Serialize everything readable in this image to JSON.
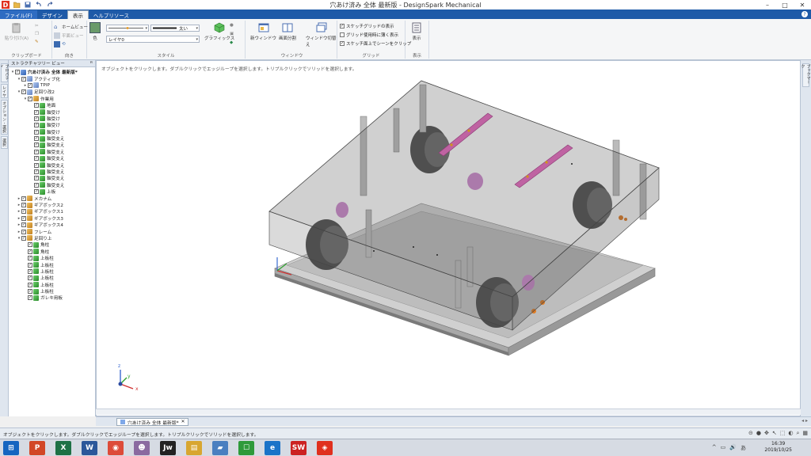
{
  "window": {
    "title": "穴あけ済み 全体 最新版 - DesignSpark Mechanical",
    "controls": {
      "minimize": "–",
      "maximize": "□",
      "close": "✕"
    }
  },
  "quick_access": {
    "icons": [
      "app-logo",
      "open-icon",
      "save-icon",
      "undo-icon",
      "redo-icon"
    ],
    "logo_letter": "D"
  },
  "tabs": {
    "items": [
      {
        "label": "ファイル(F)"
      },
      {
        "label": "デザイン"
      },
      {
        "label": "表示"
      },
      {
        "label": "ヘルプリソース"
      }
    ],
    "active_index": 2,
    "help": "?"
  },
  "ribbon": {
    "clipboard": {
      "paste": "貼り付け(A)",
      "group": "クリップボード"
    },
    "orient": {
      "home": "ホームビュー",
      "plane": "平面ビュー",
      "group": "向き"
    },
    "style": {
      "color": "色",
      "weight": "太い",
      "layer": "レイヤ0",
      "graphics": "グラフィックス",
      "group": "スタイル"
    },
    "window": {
      "new_window": "新ウィンドウ",
      "split": "画面分割",
      "switch": "ウィンドウ切替え",
      "group": "ウィンドウ"
    },
    "grid": {
      "options": [
        {
          "label": "スケッチグリッドの表示",
          "checked": true
        },
        {
          "label": "グリッド使用時に薄く表示",
          "checked": false
        },
        {
          "label": "スケッチ面上でシーンをクリップ",
          "checked": true
        }
      ],
      "group": "グリッド"
    },
    "display": {
      "label": "表示",
      "group": "表示"
    }
  },
  "left_strip": {
    "tabs": [
      "プロパティ",
      "レイヤ",
      "オプション - 選択",
      "選択"
    ]
  },
  "right_strip": {
    "tabs": [
      "ブックマーク"
    ]
  },
  "structure_panel": {
    "title": "ストラクチャツリー ビュー",
    "pin": "ꟸ",
    "items": [
      {
        "label": "穴あけ済み 全体 最新版*",
        "level": 0,
        "icon": "root",
        "expand": "▾",
        "bold": true
      },
      {
        "label": "アクティブ化",
        "level": 1,
        "icon": "plane",
        "expand": "▾"
      },
      {
        "label": "TPIP",
        "level": 2,
        "icon": "plane",
        "expand": "▸"
      },
      {
        "label": "足回り改2",
        "level": 1,
        "icon": "plane",
        "expand": "▾"
      },
      {
        "label": "作業用",
        "level": 2,
        "icon": "comp",
        "expand": "▾"
      },
      {
        "label": "地面",
        "level": 3,
        "icon": "body",
        "expand": ""
      },
      {
        "label": "軸受け",
        "level": 3,
        "icon": "body",
        "expand": ""
      },
      {
        "label": "軸受け",
        "level": 3,
        "icon": "body",
        "expand": ""
      },
      {
        "label": "軸受け",
        "level": 3,
        "icon": "body",
        "expand": ""
      },
      {
        "label": "軸受け",
        "level": 3,
        "icon": "body",
        "expand": ""
      },
      {
        "label": "軸受支え",
        "level": 3,
        "icon": "body",
        "expand": ""
      },
      {
        "label": "軸受支え",
        "level": 3,
        "icon": "body",
        "expand": ""
      },
      {
        "label": "軸受支え",
        "level": 3,
        "icon": "body",
        "expand": ""
      },
      {
        "label": "軸受支え",
        "level": 3,
        "icon": "body",
        "expand": ""
      },
      {
        "label": "軸受支え",
        "level": 3,
        "icon": "body",
        "expand": ""
      },
      {
        "label": "軸受支え",
        "level": 3,
        "icon": "body",
        "expand": ""
      },
      {
        "label": "軸受支え",
        "level": 3,
        "icon": "body",
        "expand": ""
      },
      {
        "label": "軸受支え",
        "level": 3,
        "icon": "body",
        "expand": ""
      },
      {
        "label": "上板",
        "level": 3,
        "icon": "body",
        "expand": ""
      },
      {
        "label": "メカナム",
        "level": 1,
        "icon": "comp",
        "expand": "▸"
      },
      {
        "label": "ギアボックス2",
        "level": 1,
        "icon": "comp",
        "expand": "▸"
      },
      {
        "label": "ギアボックス1",
        "level": 1,
        "icon": "comp",
        "expand": "▸"
      },
      {
        "label": "ギアボックス3",
        "level": 1,
        "icon": "comp",
        "expand": "▸"
      },
      {
        "label": "ギアボックス4",
        "level": 1,
        "icon": "comp",
        "expand": "▸"
      },
      {
        "label": "フレーム",
        "level": 1,
        "icon": "comp",
        "expand": "▸"
      },
      {
        "label": "足回り上",
        "level": 1,
        "icon": "comp",
        "expand": "▾"
      },
      {
        "label": "角柱",
        "level": 2,
        "icon": "body",
        "expand": ""
      },
      {
        "label": "角柱",
        "level": 2,
        "icon": "body",
        "expand": ""
      },
      {
        "label": "上板柱",
        "level": 2,
        "icon": "body",
        "expand": ""
      },
      {
        "label": "上板柱",
        "level": 2,
        "icon": "body",
        "expand": ""
      },
      {
        "label": "上板柱",
        "level": 2,
        "icon": "body",
        "expand": ""
      },
      {
        "label": "上板柱",
        "level": 2,
        "icon": "body",
        "expand": ""
      },
      {
        "label": "上板柱",
        "level": 2,
        "icon": "body",
        "expand": ""
      },
      {
        "label": "上板柱",
        "level": 2,
        "icon": "body",
        "expand": ""
      },
      {
        "label": "ガレキ用板",
        "level": 2,
        "icon": "body",
        "expand": ""
      }
    ]
  },
  "viewport": {
    "hint": "オブジェクトをクリックします。ダブルクリックでエッジループを選択します。トリプルクリックでソリッドを選択します。",
    "axes": {
      "x": "x",
      "y": "y",
      "z": "z"
    }
  },
  "document_tab": {
    "label": "穴あけ済み 全体 最新版*",
    "close": "✕",
    "nav": "◂ ▸"
  },
  "status_bar": {
    "message": "オブジェクトをクリックします。ダブルクリックでエッジループを選択します。トリプルクリックでソリッドを選択します。"
  },
  "taskbar": {
    "apps": [
      {
        "name": "windows-start",
        "label": "⊞",
        "color": "#1565c0"
      },
      {
        "name": "powerpoint",
        "label": "P",
        "color": "#d24726"
      },
      {
        "name": "excel",
        "label": "X",
        "color": "#1e7145"
      },
      {
        "name": "word",
        "label": "W",
        "color": "#2b579a"
      },
      {
        "name": "chrome",
        "label": "◉",
        "color": "#dd4b39"
      },
      {
        "name": "cheese",
        "label": "☻",
        "color": "#8a6aa0"
      },
      {
        "name": "jww",
        "label": "Jw",
        "color": "#222222"
      },
      {
        "name": "explorer",
        "label": "▤",
        "color": "#d8a630"
      },
      {
        "name": "notebook",
        "label": "▰",
        "color": "#4a7fc0"
      },
      {
        "name": "onenote",
        "label": "☐",
        "color": "#2e9a3a"
      },
      {
        "name": "edge",
        "label": "e",
        "color": "#1a73c8"
      },
      {
        "name": "solidworks",
        "label": "SW",
        "color": "#cc2222"
      },
      {
        "name": "designspark",
        "label": "◈",
        "color": "#e0301e"
      }
    ],
    "time": "16:39",
    "date": "2019/10/25",
    "tray": [
      "^",
      "▭",
      "🔊",
      "あ"
    ]
  },
  "model_colors": {
    "plate": "#888888",
    "wheel": "#555555",
    "rail": "#e040a0",
    "roller": "#cc88cc"
  }
}
